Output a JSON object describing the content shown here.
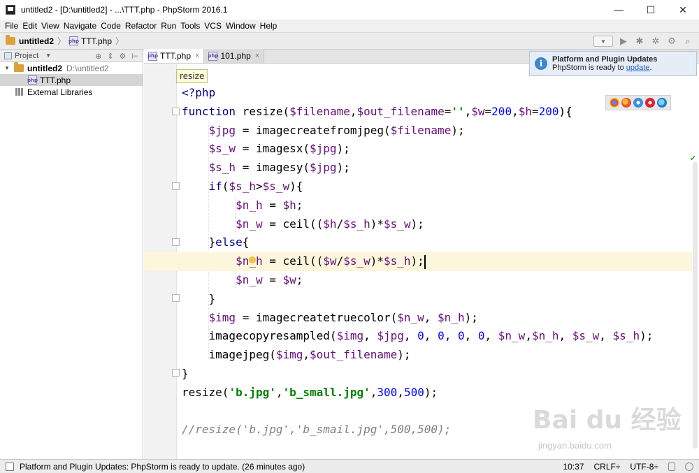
{
  "window": {
    "title": "untitled2 - [D:\\untitled2] - ...\\TTT.php - PhpStorm 2016.1",
    "minimize": "—",
    "maximize": "☐",
    "close": "✕"
  },
  "menu": [
    "File",
    "Edit",
    "View",
    "Navigate",
    "Code",
    "Refactor",
    "Run",
    "Tools",
    "VCS",
    "Window",
    "Help"
  ],
  "breadcrumb": {
    "project": "untitled2",
    "separator": "〉",
    "file": "TTT.php",
    "separator2": "〉"
  },
  "sidebar": {
    "header": "Project",
    "tree": [
      {
        "label": "untitled2",
        "path": "D:\\untitled2"
      },
      {
        "label": "TTT.php"
      },
      {
        "label": "External Libraries"
      }
    ]
  },
  "tabs": [
    {
      "label": "TTT.php",
      "close": "×"
    },
    {
      "label": "101.php",
      "close": "×"
    }
  ],
  "tooltip": "resize",
  "notification": {
    "title": "Platform and Plugin Updates",
    "text_prefix": "PhpStorm is ready to ",
    "link": "update",
    "text_suffix": "."
  },
  "code": {
    "l1": "<?php",
    "l2": {
      "a": "function ",
      "b": "resize(",
      "c": "$filename",
      "d": ",",
      "e": "$out_filename",
      "f": "=",
      "g": "''",
      "h": ",",
      "i": "$w",
      "j": "=",
      "k": "200",
      "l": ",",
      "m": "$h",
      "n": "=",
      "o": "200",
      "p": "){"
    },
    "l3": {
      "a": "$jpg",
      "b": " = imagecreatefromjpeg(",
      "c": "$filename",
      "d": ");"
    },
    "l4": {
      "a": "$s_w",
      "b": " = imagesx(",
      "c": "$jpg",
      "d": ");"
    },
    "l5": {
      "a": "$s_h",
      "b": " = imagesy(",
      "c": "$jpg",
      "d": ");"
    },
    "l6": {
      "a": "if",
      "b": "(",
      "c": "$s_h",
      "d": ">",
      "e": "$s_w",
      "f": "){"
    },
    "l7": {
      "a": "$n_h",
      "b": " = ",
      "c": "$h",
      "d": ";"
    },
    "l8": {
      "a": "$n_w",
      "b": " = ceil((",
      "c": "$h",
      "d": "/",
      "e": "$s_h",
      "f": ")*",
      "g": "$s_w",
      "h": ");"
    },
    "l9": {
      "a": "}",
      "b": "else",
      "c": "{"
    },
    "l10": {
      "a": "$n_h",
      "b": " = ceil((",
      "c": "$w",
      "d": "/",
      "e": "$s_w",
      "f": ")*",
      "g": "$s_h",
      "h": ");"
    },
    "l11": {
      "a": "$n_w",
      "b": " = ",
      "c": "$w",
      "d": ";"
    },
    "l12": "}",
    "l13": {
      "a": "$img",
      "b": " = imagecreatetruecolor(",
      "c": "$n_w",
      "d": ", ",
      "e": "$n_h",
      "f": ");"
    },
    "l14": {
      "a": "imagecopyresampled(",
      "b": "$img",
      "c": ", ",
      "d": "$jpg",
      "e": ", ",
      "f": "0",
      "g": ", ",
      "h": "0",
      "i": ", ",
      "j": "0",
      "k": ", ",
      "l": "0",
      "m": ", ",
      "n": "$n_w",
      "o": ",",
      "p": "$n_h",
      "q": ", ",
      "r": "$s_w",
      "s": ", ",
      "t": "$s_h",
      "u": ");"
    },
    "l15": {
      "a": "imagejpeg(",
      "b": "$img",
      "c": ",",
      "d": "$out_filename",
      "e": ");"
    },
    "l16": "}",
    "l17": {
      "a": "resize(",
      "b": "'b.jpg'",
      "c": ",",
      "d": "'b_small.jpg'",
      "e": ",",
      "f": "300",
      "g": ",",
      "h": "500",
      "i": ");"
    },
    "l18": "//resize('b.jpg','b_smail.jpg',500,500);"
  },
  "watermark": {
    "main": "Bai du 经验",
    "sub": "jingyan.baidu.com"
  },
  "status": {
    "message": "Platform and Plugin Updates: PhpStorm is ready to update. (26 minutes ago)",
    "position": "10:37",
    "line_sep": "CRLF÷",
    "encoding": "UTF-8÷"
  },
  "colors": {
    "keyword": "#000080",
    "variable": "#660e7a",
    "string": "#008000",
    "number": "#0000ff",
    "comment": "#808080",
    "current_line": "#fcf6dd"
  }
}
